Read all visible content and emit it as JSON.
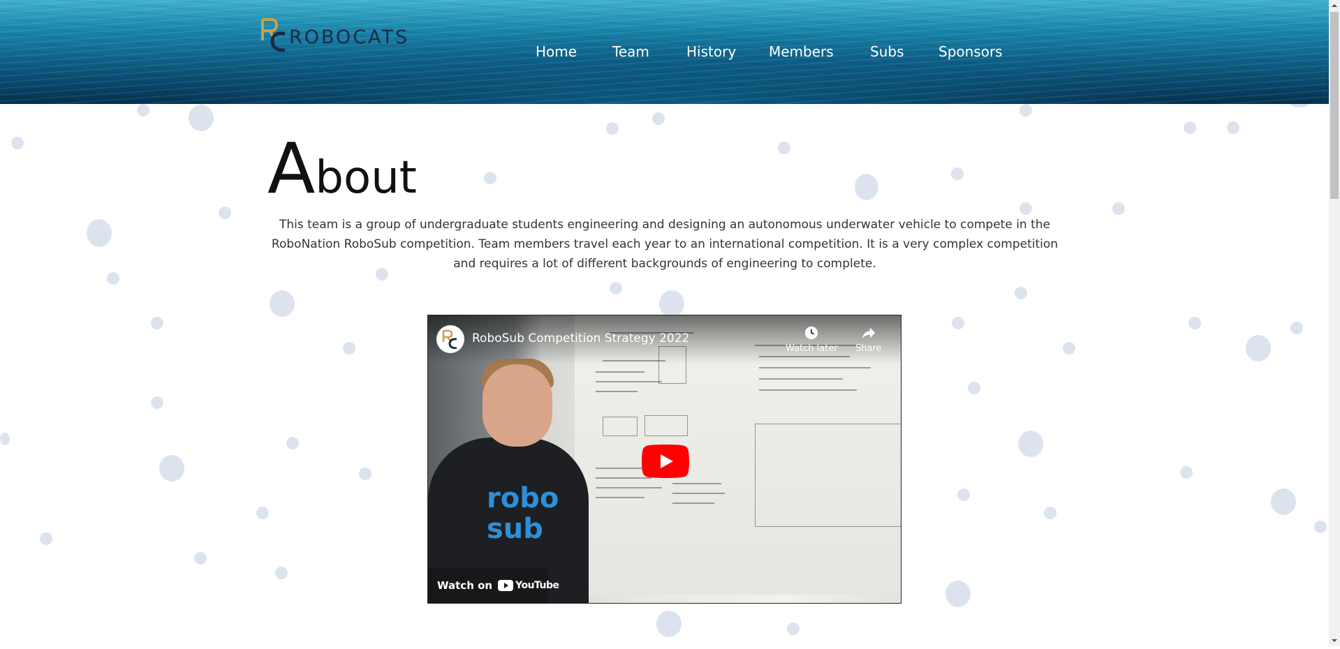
{
  "header": {
    "logo_text": "ROBOCATS",
    "nav": [
      "Home",
      "Team",
      "History",
      "Members",
      "Subs",
      "Sponsors"
    ]
  },
  "about": {
    "title_initial": "A",
    "title_rest": "bout",
    "description": "This team is a group of undergraduate students engineering and designing an autonomous underwater vehicle to compete in the RoboNation RoboSub competition. Team members travel each year to an international competition. It is a very complex competition and requires a lot of different backgrounds of engineering to complete."
  },
  "video": {
    "title": "RoboSub Competition Strategy 2022",
    "watch_later": "Watch later",
    "share": "Share",
    "watch_on": "Watch on",
    "youtube_wordmark": "YouTube",
    "shirt_text": [
      "robo",
      "sub"
    ]
  },
  "colors": {
    "header_deep": "#06304f",
    "header_light": "#3fb2cf",
    "bubble": "#dde3ee",
    "youtube_red": "#ff0000",
    "logo_gold": "#c9a04a",
    "logo_navy": "#1a2a44"
  },
  "icons": {
    "watch_later": "clock-icon",
    "share": "share-arrow-icon",
    "play": "youtube-play-icon",
    "youtube": "youtube-logo-icon",
    "scroll_up": "scroll-up-arrow-icon",
    "scroll_down": "scroll-down-arrow-icon"
  }
}
